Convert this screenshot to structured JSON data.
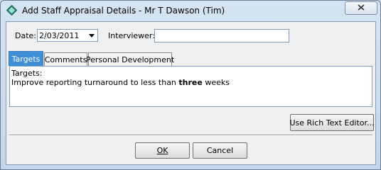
{
  "window": {
    "title": "Add Staff Appraisal Details - Mr T Dawson (Tim)"
  },
  "form": {
    "date_label": "Date:",
    "date_value": "2/03/2011",
    "interviewer_label": "Interviewer:",
    "interviewer_value": ""
  },
  "tabs": [
    {
      "label": "Targets",
      "active": true
    },
    {
      "label": "Comments",
      "active": false
    },
    {
      "label": "Personal Development",
      "active": false
    }
  ],
  "editor": {
    "line1": "Targets:",
    "line2_before": "Improve reporting turnaround to less than ",
    "line2_bold": "three",
    "line2_after": " weeks"
  },
  "buttons": {
    "rich_text": "Use Rich Text Editor...",
    "ok": "OK",
    "cancel": "Cancel"
  },
  "icons": {
    "app": "diamond-app-icon",
    "close": "close-icon",
    "dropdown": "chevron-down-icon"
  }
}
